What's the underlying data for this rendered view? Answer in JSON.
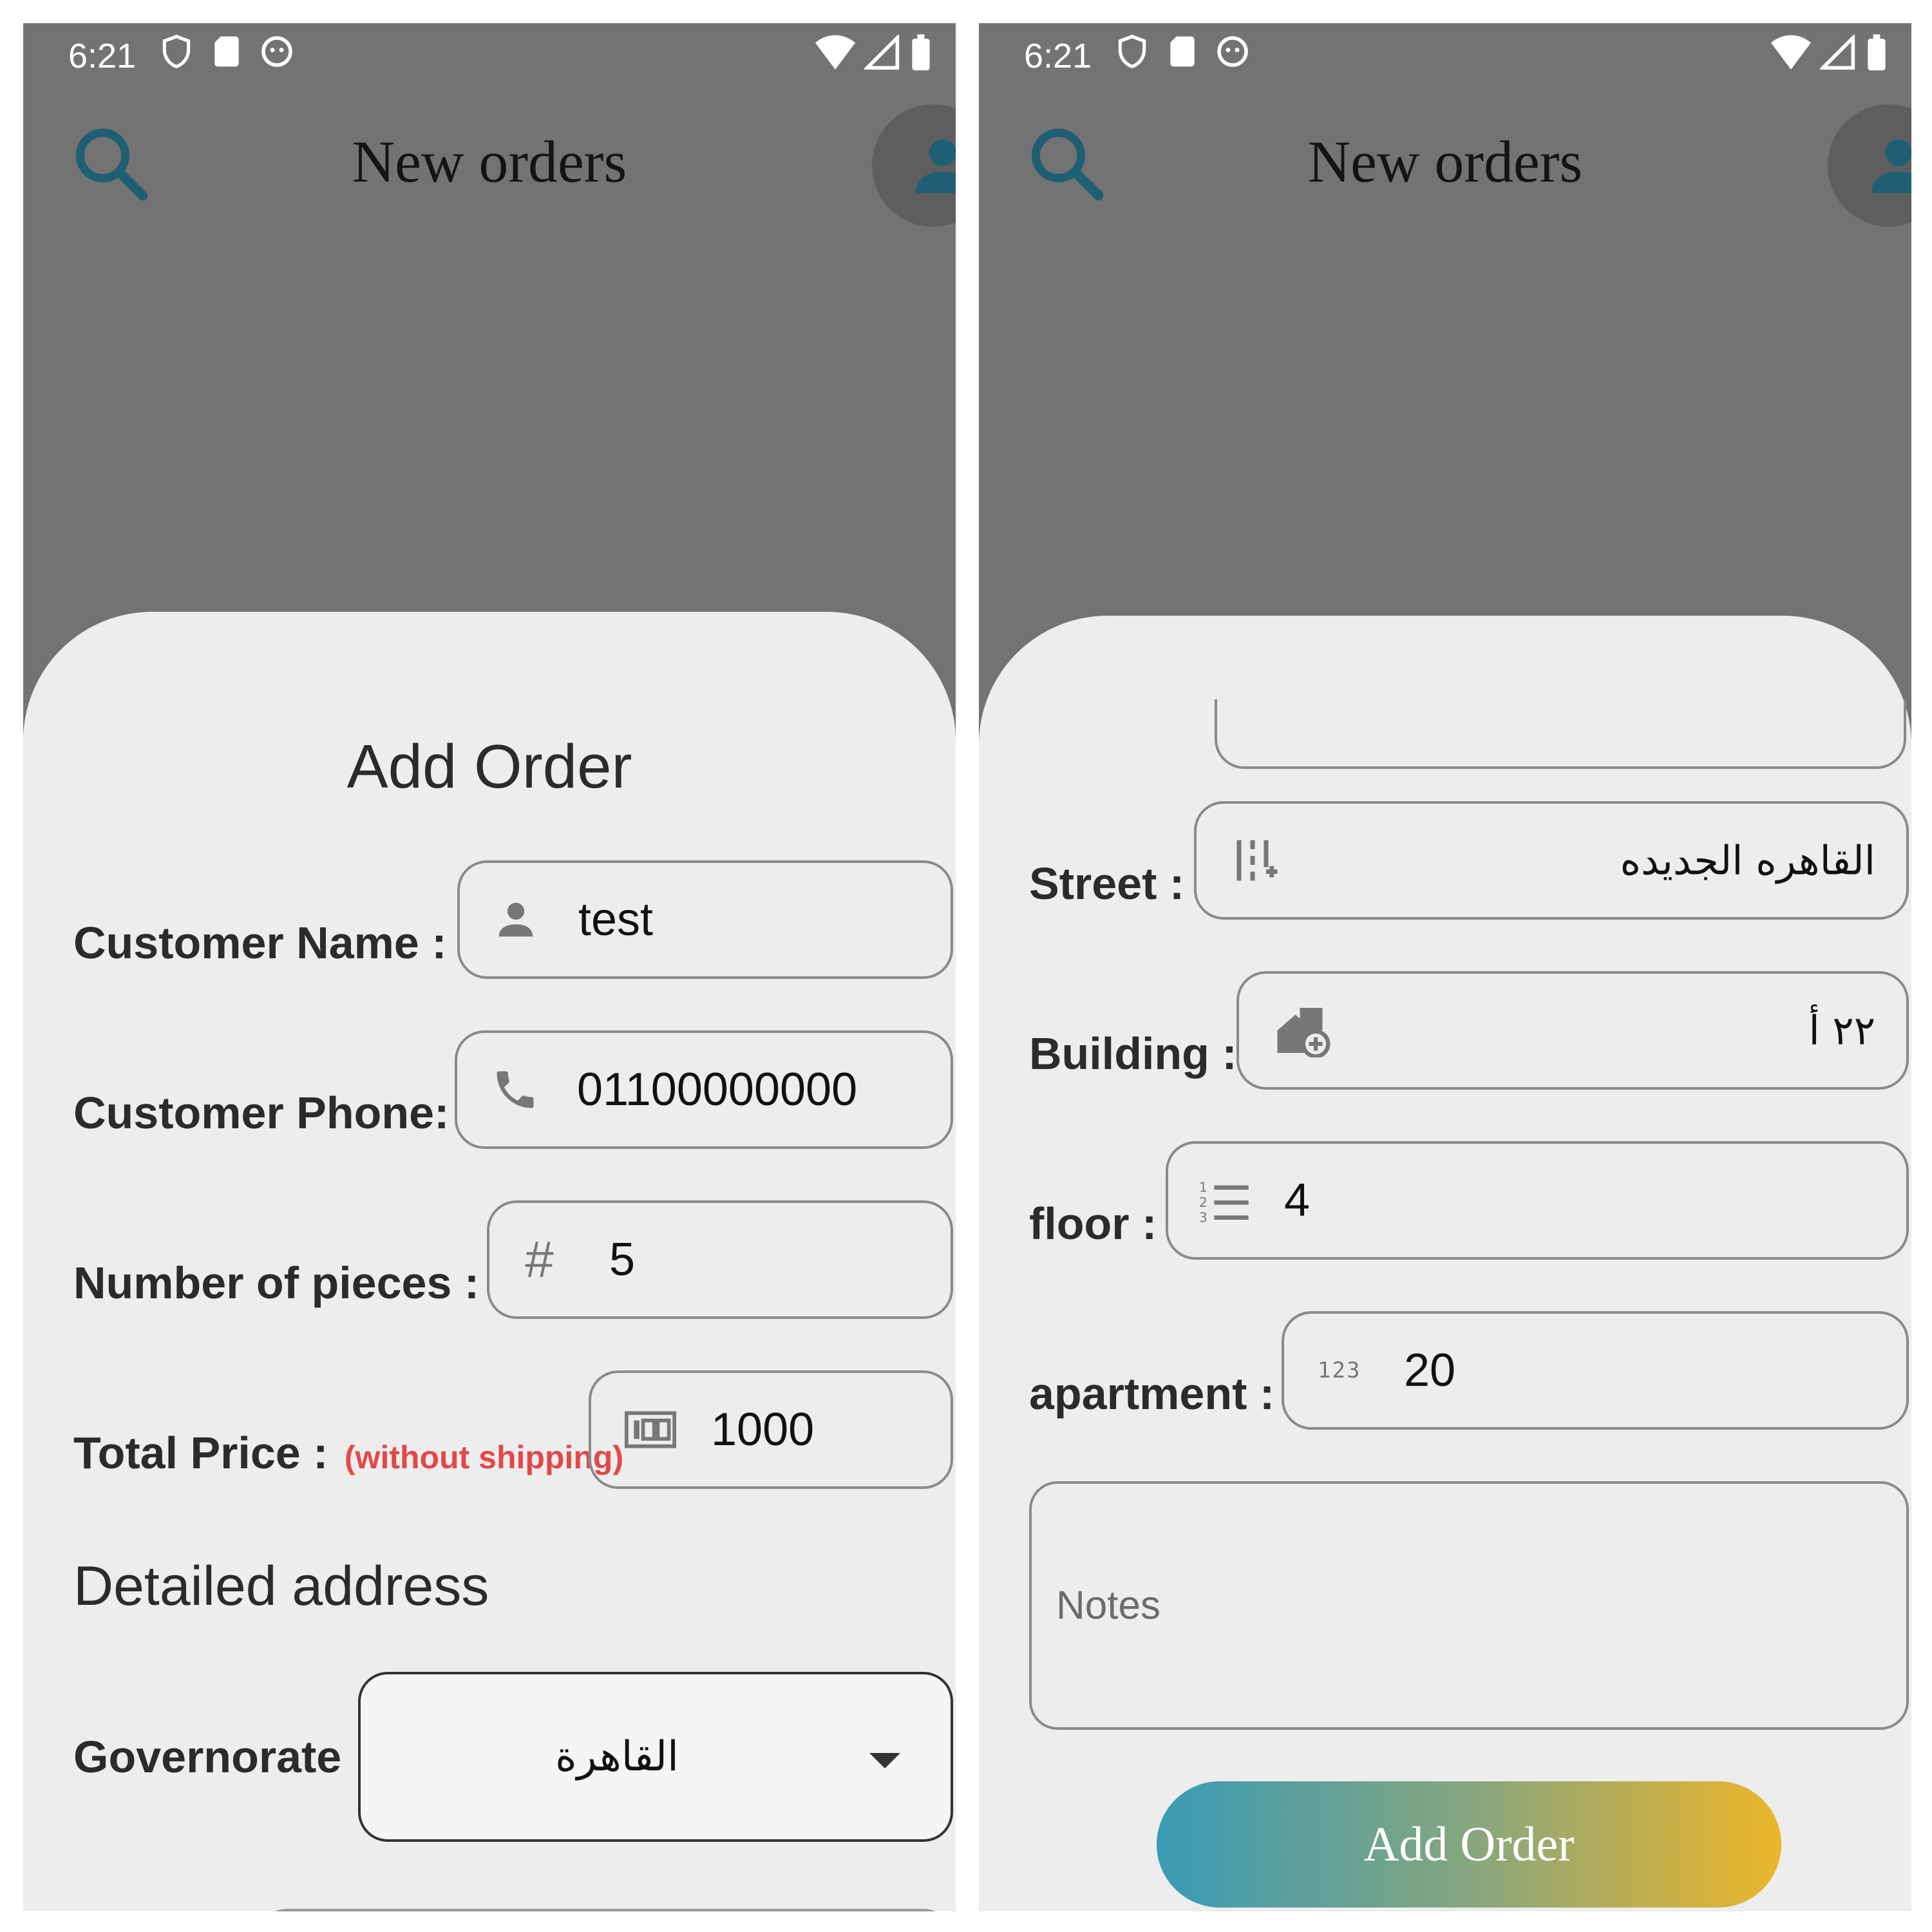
{
  "status_bar": {
    "time": "6:21"
  },
  "app_bar": {
    "title": "New orders"
  },
  "colors": {
    "accent": "#1f5f73",
    "note_red": "#e24848",
    "button_gradient_start": "#3a9bb6",
    "button_gradient_end": "#ebb62a"
  },
  "left_screen": {
    "sheet_title": "Add Order",
    "fields": {
      "customer_name": {
        "label": "Customer Name :",
        "value": "test",
        "icon": "person-icon"
      },
      "customer_phone": {
        "label": "Customer Phone:",
        "value": "01100000000",
        "icon": "phone-icon"
      },
      "number_of_pieces": {
        "label": "Number of pieces :",
        "value": "5",
        "icon": "hash-icon"
      },
      "total_price": {
        "label": "Total Price :",
        "note": "(without shipping)",
        "value": "1000",
        "icon": "money-icon"
      }
    },
    "section_heading": "Detailed address",
    "governorate": {
      "label": "Governorate :",
      "selected": "القاهرة"
    }
  },
  "right_screen": {
    "fields": {
      "street": {
        "label": "Street :",
        "value": "القاهره الجديده",
        "icon": "street-icon"
      },
      "building": {
        "label": "Building :",
        "value": "٢٢ أ",
        "icon": "building-add-icon"
      },
      "floor": {
        "label": "floor :",
        "value": "4",
        "icon": "numbered-list-icon"
      },
      "apartment": {
        "label": "apartment :",
        "value": "20",
        "icon": "numbers-icon"
      }
    },
    "notes_placeholder": "Notes",
    "submit_label": "Add Order"
  }
}
